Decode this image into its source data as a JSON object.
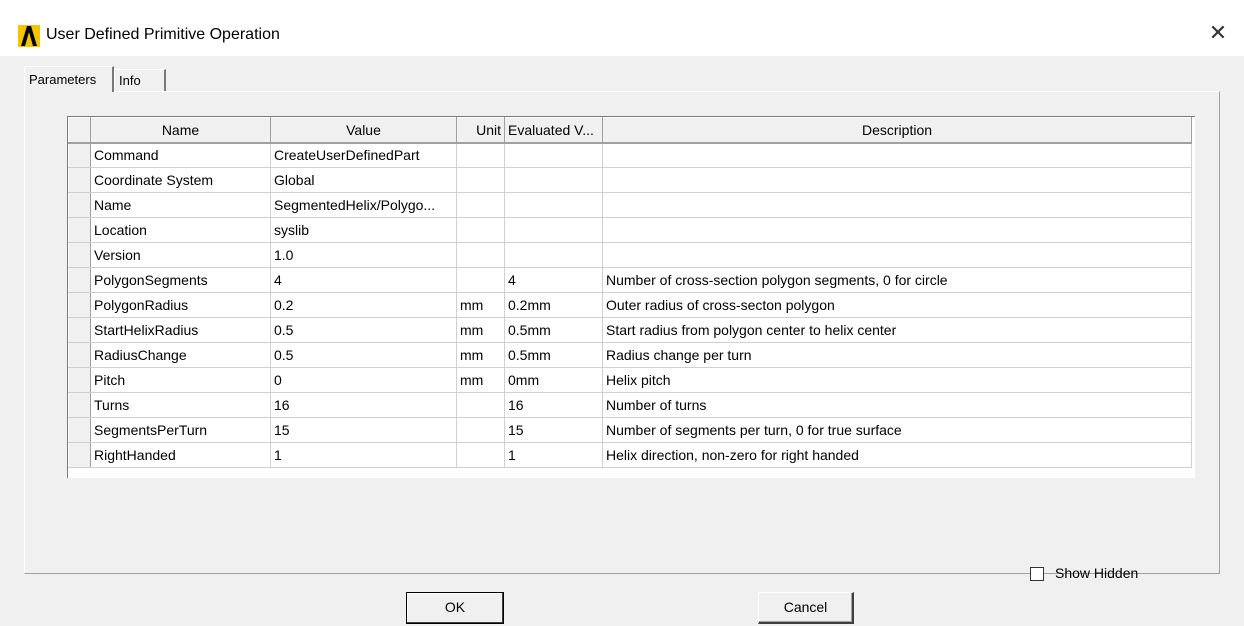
{
  "window": {
    "title": "User Defined Primitive Operation",
    "logo_icon": "ansys-logo-icon",
    "close_label": "✕"
  },
  "tabs": [
    {
      "label": "Parameters",
      "active": true
    },
    {
      "label": "Info",
      "active": false
    }
  ],
  "grid": {
    "columns": [
      "Name",
      "Value",
      "Unit",
      "Evaluated V...",
      "Description"
    ],
    "rows": [
      {
        "name": "Command",
        "value": "CreateUserDefinedPart",
        "unit": "",
        "evaluated": "",
        "description": ""
      },
      {
        "name": "Coordinate System",
        "value": "Global",
        "unit": "",
        "evaluated": "",
        "description": ""
      },
      {
        "name": "Name",
        "value": "SegmentedHelix/Polygo...",
        "unit": "",
        "evaluated": "",
        "description": ""
      },
      {
        "name": "Location",
        "value": "syslib",
        "unit": "",
        "evaluated": "",
        "description": ""
      },
      {
        "name": "Version",
        "value": "1.0",
        "unit": "",
        "evaluated": "",
        "description": ""
      },
      {
        "name": "PolygonSegments",
        "value": "4",
        "unit": "",
        "evaluated": "4",
        "description": "Number of cross-section polygon segments, 0 for circle"
      },
      {
        "name": "PolygonRadius",
        "value": "0.2",
        "unit": "mm",
        "evaluated": "0.2mm",
        "description": "Outer radius of cross-secton polygon"
      },
      {
        "name": "StartHelixRadius",
        "value": "0.5",
        "unit": "mm",
        "evaluated": "0.5mm",
        "description": "Start radius from polygon center to helix center"
      },
      {
        "name": "RadiusChange",
        "value": "0.5",
        "unit": "mm",
        "evaluated": "0.5mm",
        "description": "Radius change per turn"
      },
      {
        "name": "Pitch",
        "value": "0",
        "unit": "mm",
        "evaluated": "0mm",
        "description": "Helix pitch"
      },
      {
        "name": "Turns",
        "value": "16",
        "unit": "",
        "evaluated": "16",
        "description": "Number of turns"
      },
      {
        "name": "SegmentsPerTurn",
        "value": "15",
        "unit": "",
        "evaluated": "15",
        "description": "Number of segments per turn, 0 for true surface"
      },
      {
        "name": "RightHanded",
        "value": "1",
        "unit": "",
        "evaluated": "1",
        "description": "Helix direction, non-zero for right handed"
      }
    ]
  },
  "show_hidden": {
    "label": "Show Hidden",
    "checked": false
  },
  "buttons": {
    "ok": "OK",
    "cancel": "Cancel"
  },
  "colors": {
    "logo_yellow": "#f5c400",
    "logo_black": "#000000",
    "dialog_bg": "#f0f0f0"
  }
}
